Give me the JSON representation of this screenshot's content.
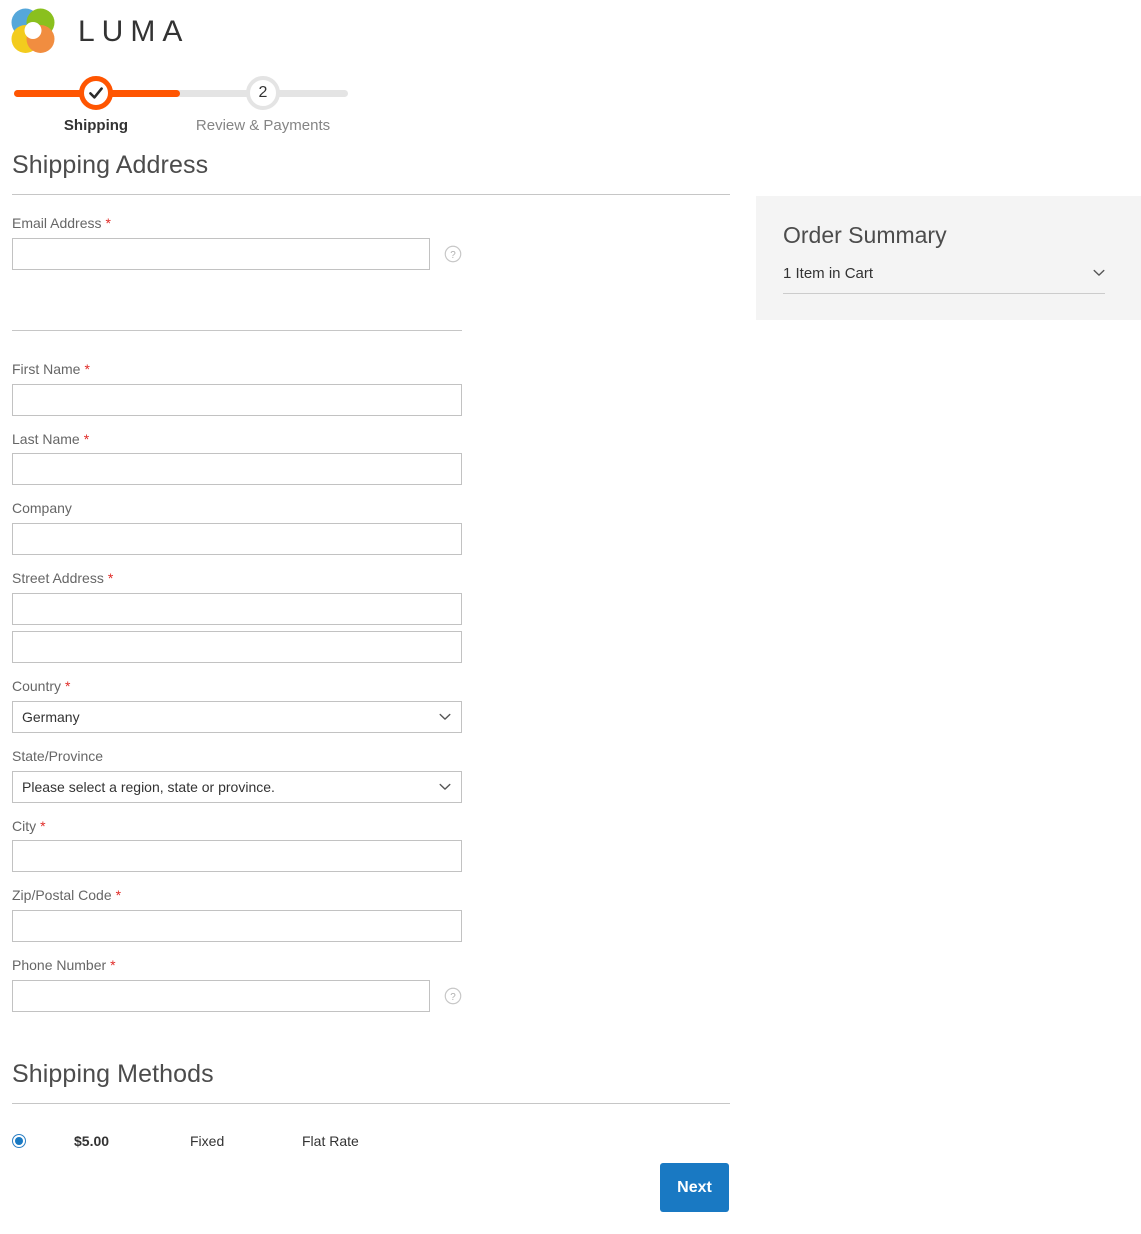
{
  "brand": {
    "name": "LUMA",
    "logo_icon": "luma-rings-logo",
    "colors": {
      "blue": "#4b9fd5",
      "green": "#7ab800",
      "yellow": "#f2c500",
      "orange": "#f07e26",
      "accent_orange": "#ff5501",
      "accent_blue": "#1979c3",
      "panel_gray": "#f4f4f4",
      "required_red": "#e02b27"
    }
  },
  "progress": {
    "steps": [
      {
        "label": "Shipping",
        "state": "done",
        "icon": "check-icon",
        "number": ""
      },
      {
        "label": "Review & Payments",
        "state": "todo",
        "icon": "",
        "number": "2"
      }
    ]
  },
  "shipping_address": {
    "title": "Shipping Address",
    "email": {
      "label": "Email Address",
      "required": "*",
      "value": "",
      "placeholder": "",
      "help_icon": "question-mark-icon"
    },
    "first_name": {
      "label": "First Name",
      "required": "*",
      "value": "",
      "placeholder": ""
    },
    "last_name": {
      "label": "Last Name",
      "required": "*",
      "value": "",
      "placeholder": ""
    },
    "company": {
      "label": "Company",
      "required": "",
      "value": "",
      "placeholder": ""
    },
    "street": {
      "label": "Street Address",
      "required": "*",
      "line1": "",
      "line2": "",
      "placeholder": ""
    },
    "country": {
      "label": "Country",
      "required": "*",
      "value": "Germany",
      "chevron_icon": "chevron-down-icon"
    },
    "region": {
      "label": "State/Province",
      "required": "",
      "value": "Please select a region, state or province.",
      "chevron_icon": "chevron-down-icon"
    },
    "city": {
      "label": "City",
      "required": "*",
      "value": "",
      "placeholder": ""
    },
    "postcode": {
      "label": "Zip/Postal Code",
      "required": "*",
      "value": "",
      "placeholder": ""
    },
    "telephone": {
      "label": "Phone Number",
      "required": "*",
      "value": "",
      "placeholder": "",
      "help_icon": "question-mark-icon"
    }
  },
  "shipping_methods": {
    "title": "Shipping Methods",
    "rows": [
      {
        "selected": true,
        "price": "$5.00",
        "carrier": "Fixed",
        "method": "Flat Rate"
      }
    ]
  },
  "actions": {
    "next_label": "Next"
  },
  "order_summary": {
    "title": "Order Summary",
    "cart_label": "1 Item in Cart",
    "chevron_icon": "chevron-down-icon"
  }
}
